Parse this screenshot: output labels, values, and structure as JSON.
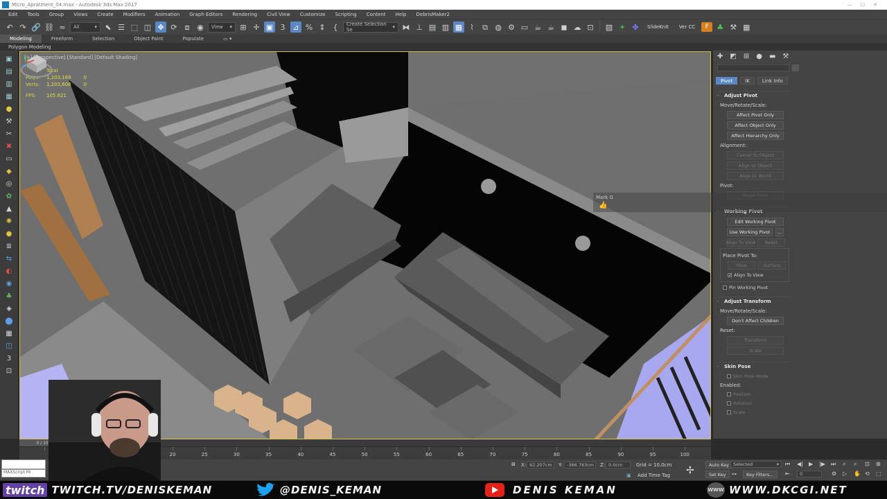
{
  "window": {
    "title": "Micro_Apratment_04.max - Autodesk 3ds Max 2017"
  },
  "menu": {
    "items": [
      "Edit",
      "Tools",
      "Group",
      "Views",
      "Create",
      "Modifiers",
      "Animation",
      "Graph Editors",
      "Rendering",
      "Civil View",
      "Customize",
      "Scripting",
      "Content",
      "Help",
      "DebrisMaker2"
    ]
  },
  "toolbar": {
    "filter_value": "All",
    "refcoord_value": "View",
    "selection_set_placeholder": "Create Selection Se",
    "slideknit_label": "SlideKnit",
    "vercc_label": "Ver CC"
  },
  "ribbon": {
    "tabs": [
      "Modeling",
      "Freeform",
      "Selection",
      "Object Paint",
      "Populate"
    ],
    "subtab": "Polygon Modeling"
  },
  "viewport": {
    "label": "[+] [Perspective] [Standard] [Default Shading]",
    "stats": {
      "total_label": "Total",
      "polys_label": "Polys:",
      "polys_value": "1,203,169",
      "polys_sel": "0",
      "verts_label": "Verts:",
      "verts_value": "1,203,608",
      "verts_sel": "0",
      "fps_label": "FPS:",
      "fps_value": "105.621"
    }
  },
  "command_panel": {
    "hierarchy_tabs": [
      "Pivot",
      "IK",
      "Link Info"
    ],
    "adjust_pivot": {
      "title": "Adjust Pivot",
      "move_label": "Move/Rotate/Scale:",
      "btn_pivot_only": "Affect Pivot Only",
      "btn_object_only": "Affect Object Only",
      "btn_hierarchy_only": "Affect Hierarchy Only",
      "alignment_label": "Alignment:",
      "btn_center": "Center to Object",
      "btn_align_object": "Align to Object",
      "btn_align_world": "Align to World",
      "pivot_label": "Pivot:",
      "btn_reset_pivot": "Reset Pivot"
    },
    "working_pivot": {
      "title": "Working Pivot",
      "btn_edit": "Edit Working Pivot",
      "btn_use": "Use Working Pivot",
      "btn_ellipsis": "...",
      "btn_align_view": "Align To View",
      "btn_reset": "Reset",
      "place_label": "Place Pivot To:",
      "btn_view": "View",
      "btn_surface": "Surface",
      "check_align_view": "Align To View",
      "check_pin": "Pin Working Pivot"
    },
    "adjust_transform": {
      "title": "Adjust Transform",
      "move_label": "Move/Rotate/Scale:",
      "btn_dont_affect": "Don't Affect Children",
      "reset_label": "Reset:",
      "btn_transform": "Transform",
      "btn_scale": "Scale"
    },
    "skin_pose": {
      "title": "Skin Pose",
      "check_mode": "Skin Pose Mode",
      "enabled_label": "Enabled:",
      "check_position": "Position",
      "check_rotation": "Rotation",
      "check_scale": "Scale"
    }
  },
  "tooltip": {
    "name": "Mark G"
  },
  "timeline": {
    "slider_label": "0 / 100",
    "ticks": [
      "20",
      "25",
      "30",
      "35",
      "40",
      "45",
      "50",
      "55",
      "60",
      "65",
      "70",
      "75",
      "80",
      "85",
      "90",
      "95",
      "100"
    ]
  },
  "status": {
    "maxscript_label": "MAXScript Mi",
    "x_label": "X:",
    "x_value": "62.207cm",
    "y_label": "Y:",
    "y_value": "-366.763cm",
    "z_label": "Z:",
    "z_value": "0.0cm",
    "grid_text": "Grid = 10.0cm",
    "add_time_tag": "Add Time Tag",
    "auto_key": "Auto Key",
    "set_key": "Set Key",
    "selected_value": "Selected",
    "key_filters": "Key Filters...",
    "frame_value": "0"
  },
  "banner": {
    "twitch_logo": "twitch",
    "twitch_url": "TWITCH.TV/DENISKEMAN",
    "twitter_handle": "@DENIS_KEMAN",
    "youtube_name": "DENIS KEMAN",
    "www_badge": "WWW",
    "website": "WWW.DKCGI.NET"
  },
  "colors": {
    "accent_blue": "#5b87c5",
    "viewport_border": "#d8c34a",
    "stats_yellow": "#e0e040",
    "twitch_purple": "#6441a5",
    "youtube_red": "#e62117",
    "twitter_blue": "#1da1f2"
  }
}
